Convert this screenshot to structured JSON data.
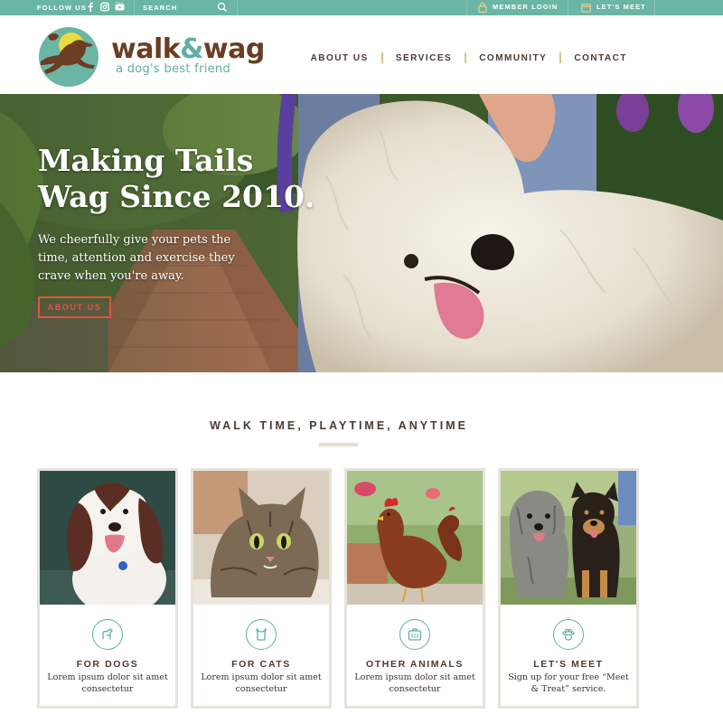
{
  "topbar": {
    "follow_label": "FOLLOW US",
    "social_icons": [
      "facebook-icon",
      "instagram-icon",
      "youtube-icon"
    ],
    "search_label": "SEARCH",
    "member_login_label": "MEMBER LOGIN",
    "lets_meet_label": "LET'S MEET"
  },
  "header": {
    "brand_word1": "walk",
    "brand_amp": "&",
    "brand_word2": "wag",
    "tagline": "a dog's best friend",
    "nav": [
      "ABOUT US",
      "SERVICES",
      "COMMUNITY",
      "CONTACT"
    ]
  },
  "hero": {
    "title_line1": "Making Tails",
    "title_line2": "Wag Since 2010.",
    "text": "We cheerfully give your pets the time, attention and exercise they crave when you're away.",
    "button_label": "ABOUT US"
  },
  "section": {
    "title": "WALK TIME, PLAYTIME, ANYTIME"
  },
  "cards": [
    {
      "title": "FOR DOGS",
      "text": "Lorem ipsum dolor sit amet consectetur",
      "icon": "dog-icon"
    },
    {
      "title": "FOR CATS",
      "text": "Lorem ipsum dolor sit amet consectetur",
      "icon": "cat-icon"
    },
    {
      "title": "OTHER ANIMALS",
      "text": "Lorem ipsum dolor sit amet consectetur",
      "icon": "pet-carrier-icon"
    },
    {
      "title": "LET'S MEET",
      "text": "Sign up for your free “Meet & Treat” service.",
      "icon": "paw-icon"
    }
  ],
  "colors": {
    "teal": "#6bb5a5",
    "brown": "#6b3d22",
    "accent_orange": "#e4553b",
    "nav_divider": "#d8c58a"
  }
}
